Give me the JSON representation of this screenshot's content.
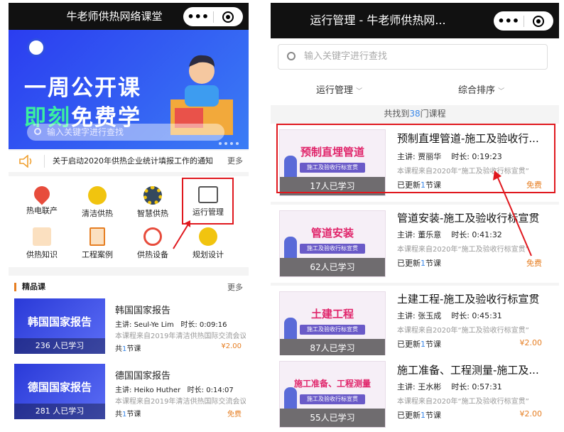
{
  "left": {
    "title": "牛老师供热网络课堂",
    "banner": {
      "line1": "一周公开课",
      "line2_highlight": "即刻",
      "line2_rest": "免费学",
      "search_placeholder": "输入关键字进行查找"
    },
    "notice": {
      "text": "关于启动2020年供热企业统计填报工作的通知",
      "more": "更多"
    },
    "grid": [
      {
        "label": "热电联产",
        "icon": "location-pin-icon",
        "color": "#e74c3c"
      },
      {
        "label": "清洁供热",
        "icon": "lightbulb-icon",
        "color": "#f1c40f"
      },
      {
        "label": "智慧供热",
        "icon": "gear-icon",
        "color": "#34495e"
      },
      {
        "label": "运行管理",
        "icon": "chart-board-icon",
        "color": "#e67e22"
      },
      {
        "label": "供热知识",
        "icon": "presentation-icon",
        "color": "#e67e22"
      },
      {
        "label": "工程案例",
        "icon": "document-icon",
        "color": "#e67e22"
      },
      {
        "label": "供热设备",
        "icon": "stopwatch-icon",
        "color": "#e74c3c"
      },
      {
        "label": "规划设计",
        "icon": "head-gear-icon",
        "color": "#f1c40f"
      }
    ],
    "featured": {
      "header": "精品课",
      "more": "更多",
      "items": [
        {
          "thumb": "韩国国家报告",
          "count": "236 人已学习",
          "title": "韩国国家报告",
          "lecturer_label": "主讲:",
          "lecturer": "Seul-Ye Lim",
          "duration_label": "时长:",
          "duration": "0:09:16",
          "desc": "本课程来自2019年清洁供热国际交流会议",
          "lessons_pre": "共",
          "lessons_n": "1",
          "lessons_post": "节课",
          "price": "¥2.00"
        },
        {
          "thumb": "德国国家报告",
          "count": "281 人已学习",
          "title": "德国国家报告",
          "lecturer_label": "主讲:",
          "lecturer": "Heiko Huther",
          "duration_label": "时长:",
          "duration": "0:14:07",
          "desc": "本课程来自2019年清洁供热国际交流会议",
          "lessons_pre": "共",
          "lessons_n": "1",
          "lessons_post": "节课",
          "price": "免费"
        }
      ]
    }
  },
  "right": {
    "title": "运行管理 - 牛老师供热网...",
    "search_placeholder": "输入关键字进行查找",
    "filter1": "运行管理",
    "filter2": "综合排序",
    "found_pre": "共找到",
    "found_n": "38",
    "found_post": "门课程",
    "courses": [
      {
        "thumb": "预制直埋管道",
        "sub": "施工及验收行标宣贯",
        "count": "17人已学习",
        "title": "预制直埋管道-施工及验收行...",
        "lecturer": "主讲: 贾丽华",
        "duration": "时长: 0:19:23",
        "desc": "本课程来自2020年“施工及验收行标宣贯”",
        "updated_pre": "已更新",
        "updated_n": "1",
        "updated_post": "节课",
        "price": "免费"
      },
      {
        "thumb": "管道安装",
        "sub": "施工及验收行标宣贯",
        "count": "62人已学习",
        "title": "管道安装-施工及验收行标宣贯",
        "lecturer": "主讲: 董乐意",
        "duration": "时长: 0:41:32",
        "desc": "本课程来自2020年“施工及验收行标宣贯”",
        "updated_pre": "已更新",
        "updated_n": "1",
        "updated_post": "节课",
        "price": "免费"
      },
      {
        "thumb": "土建工程",
        "sub": "施工及验收行标宣贯",
        "count": "87人已学习",
        "title": "土建工程-施工及验收行标宣贯",
        "lecturer": "主讲: 张玉成",
        "duration": "时长: 0:45:31",
        "desc": "本课程来自2020年“施工及验收行标宣贯”",
        "updated_pre": "已更新",
        "updated_n": "1",
        "updated_post": "节课",
        "price": "¥2.00"
      },
      {
        "thumb": "施工准备、工程测量",
        "sub": "施工及验收行标宣贯",
        "count": "55人已学习",
        "title": "施工准备、工程测量-施工及...",
        "lecturer": "主讲: 王水彬",
        "duration": "时长: 0:57:31",
        "desc": "本课程来自2020年“施工及验收行标宣贯”",
        "updated_pre": "已更新",
        "updated_n": "1",
        "updated_post": "节课",
        "price": "¥2.00"
      }
    ]
  },
  "capsule": {
    "dots": "•••"
  },
  "colors": {
    "accent_red": "#e0181e",
    "price": "#e67e22",
    "link_blue": "#3a88e8"
  }
}
